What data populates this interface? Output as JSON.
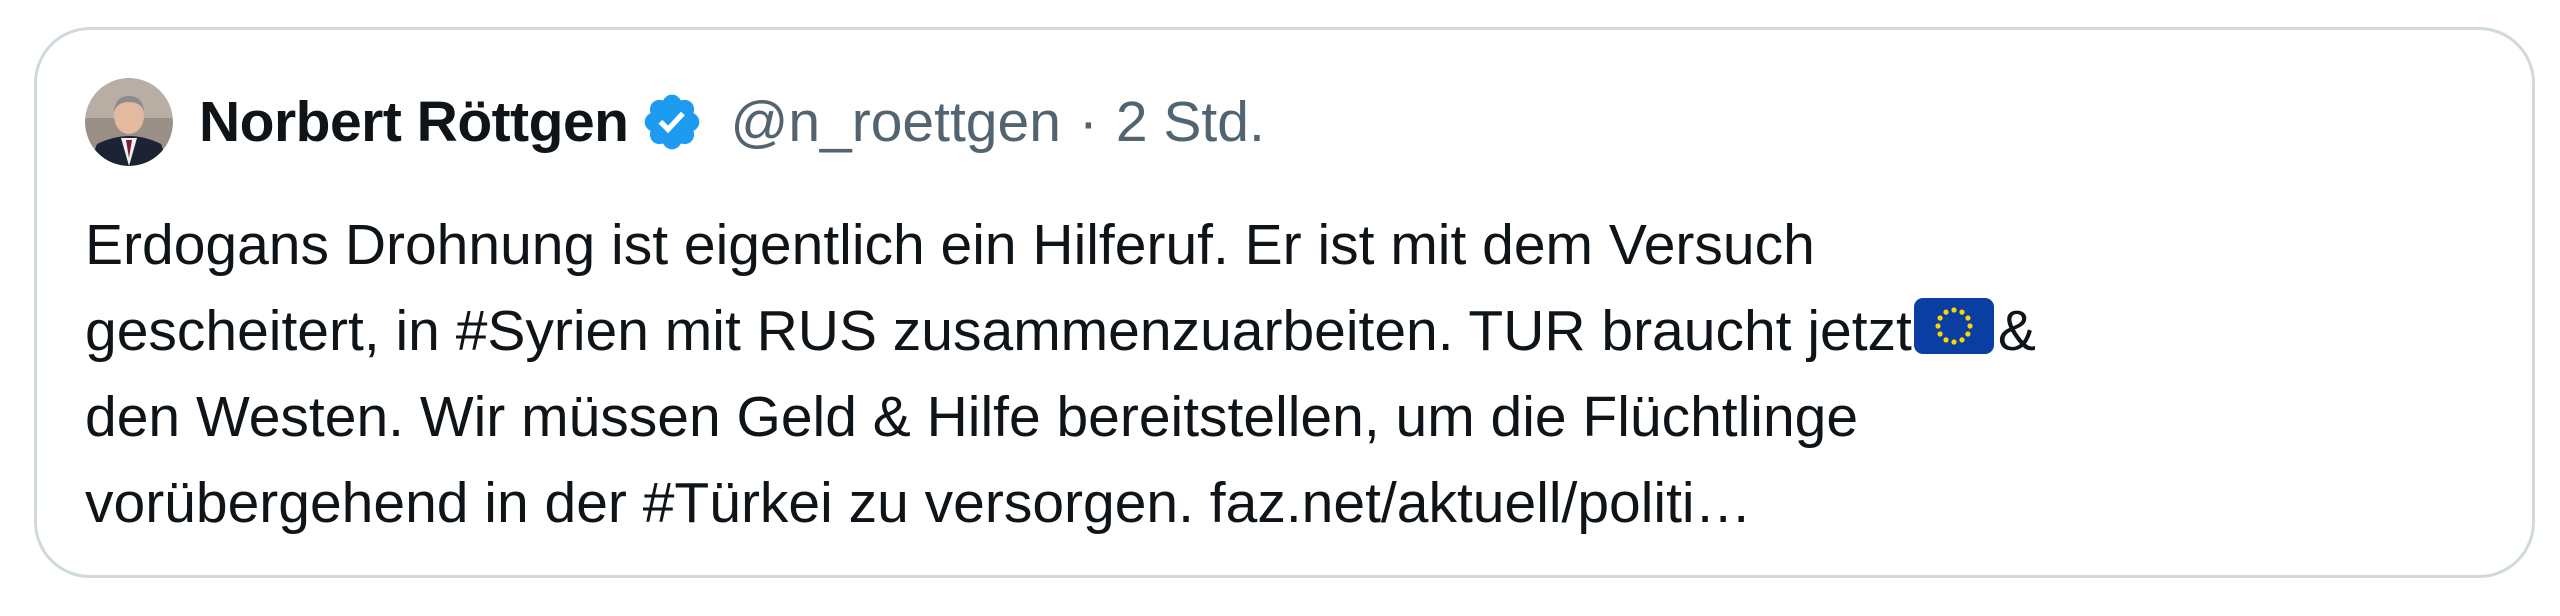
{
  "tweet": {
    "author_name": "Norbert Röttgen",
    "handle": "@n_roettgen",
    "separator": "·",
    "time": "2 Std.",
    "icons": {
      "avatar": "avatar",
      "verified": "verified-badge-icon",
      "emoji": "eu-flag-emoji"
    },
    "colors": {
      "verified": "#1d9bf0",
      "text": "#0f1419",
      "muted": "#536471",
      "border": "#cfd9de"
    },
    "lines": {
      "l1": "Erdogans Drohnung ist eigentlich ein Hilferuf. Er ist mit dem Versuch",
      "l2a": "gescheitert, in #Syrien mit RUS zusammenzuarbeiten. TUR braucht jetzt",
      "l2b": "&",
      "l3": "den Westen. Wir müssen Geld & Hilfe bereitstellen, um die Flüchtlinge",
      "l4": "vorübergehend in der #Türkei zu versorgen. faz.net/aktuell/politi…"
    }
  }
}
